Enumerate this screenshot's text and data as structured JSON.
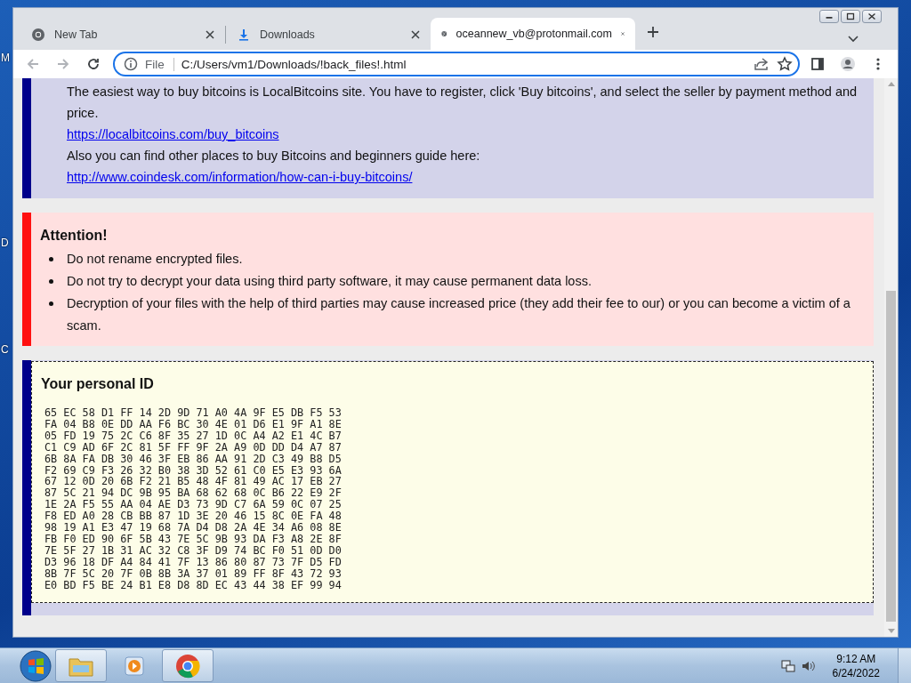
{
  "desktop": {
    "icon_labels": [
      "M",
      "D",
      "C"
    ]
  },
  "browser": {
    "tabs": [
      {
        "kind": "newtab",
        "title": "New Tab",
        "selected": false
      },
      {
        "kind": "downloads",
        "title": "Downloads",
        "selected": false
      },
      {
        "kind": "page",
        "title": "oceannew_vb@protonmail.com",
        "selected": true
      }
    ],
    "address_bar": {
      "scheme": "File",
      "url": "C:/Users/vm1/Downloads/!back_files!.html"
    }
  },
  "page": {
    "info_block": {
      "lines": [
        {
          "kind": "text",
          "text": "The easiest way to buy bitcoins is LocalBitcoins site. You have to register, click 'Buy bitcoins', and select the seller by payment method and price."
        },
        {
          "kind": "link",
          "text": "https://localbitcoins.com/buy_bitcoins"
        },
        {
          "kind": "text",
          "text": "Also you can find other places to buy Bitcoins and beginners guide here:"
        },
        {
          "kind": "link",
          "text": "http://www.coindesk.com/information/how-can-i-buy-bitcoins/"
        }
      ]
    },
    "attention": {
      "title": "Attention!",
      "items": [
        "Do not rename encrypted files.",
        "Do not try to decrypt your data using third party software, it may cause permanent data loss.",
        "Decryption of your files with the help of third parties may cause increased price (they add their fee to our) or you can become a victim of a scam."
      ]
    },
    "personal_id": {
      "title": "Your personal ID",
      "hex_lines": [
        "65 EC 58 D1 FF 14 2D 9D 71 A0 4A 9F E5 DB F5 53",
        "FA 04 B8 0E DD AA F6 BC 30 4E 01 D6 E1 9F A1 8E",
        "05 FD 19 75 2C C6 8F 35 27 1D 0C A4 A2 E1 4C B7",
        "C1 C9 AD 6F 2C 81 5F FF 9F 2A A9 0D DD D4 A7 87",
        "6B 8A FA DB 30 46 3F EB 86 AA 91 2D C3 49 B8 D5",
        "F2 69 C9 F3 26 32 B0 38 3D 52 61 C0 E5 E3 93 6A",
        "67 12 0D 20 6B F2 21 B5 48 4F 81 49 AC 17 EB 27",
        "87 5C 21 94 DC 9B 95 BA 68 62 68 0C B6 22 E9 2F",
        "1E 2A F5 55 AA 04 AE D3 73 9D C7 6A 59 0C 07 25",
        "F8 ED A0 28 CB BB 87 1D 3E 20 46 15 8C 0E FA 48",
        "98 19 A1 E3 47 19 68 7A D4 D8 2A 4E 34 A6 08 8E",
        "FB F0 ED 90 6F 5B 43 7E 5C 9B 93 DA F3 A8 2E 8F",
        "7E 5F 27 1B 31 AC 32 C8 3F D9 74 BC F0 51 0D D0",
        "D3 96 18 DF A4 84 41 7F 13 86 80 87 73 7F D5 FD",
        "8B 7F 5C 20 7F 0B 8B 3A 37 01 89 FF 8F 43 72 93",
        "E0 BD F5 BE 24 B1 E8 D8 8D EC 43 44 38 EF 99 94"
      ]
    }
  },
  "taskbar": {
    "apps": [
      {
        "kind": "explorer",
        "running": true
      },
      {
        "kind": "media",
        "running": false
      },
      {
        "kind": "chrome",
        "running": true
      }
    ],
    "clock": {
      "time": "9:12 AM",
      "date": "6/24/2022"
    }
  }
}
